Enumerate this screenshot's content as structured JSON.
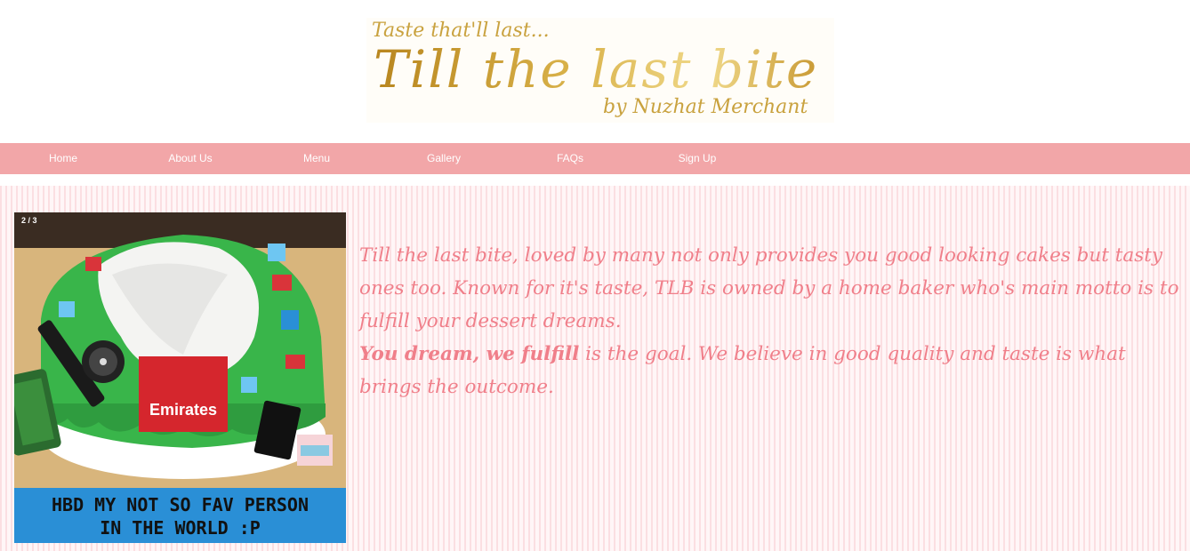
{
  "header": {
    "logo": {
      "tagline": "Taste that'll last...",
      "title": "Till the last bite",
      "byline": "by Nuzhat Merchant"
    }
  },
  "nav": {
    "items": [
      {
        "label": "Home"
      },
      {
        "label": "About Us"
      },
      {
        "label": "Menu"
      },
      {
        "label": "Gallery"
      },
      {
        "label": "FAQs"
      },
      {
        "label": "Sign Up"
      }
    ]
  },
  "slider": {
    "counter": "2 / 3",
    "image_label": "Emirates",
    "caption_line1": "HBD MY NOT SO FAV PERSON",
    "caption_line2": "IN THE WORLD :P"
  },
  "intro": {
    "paragraph1": "Till the last bite, loved by many not only provides you good looking cakes but tasty ones too. Known for it's taste, TLB is owned by a home baker who's main motto is to fulfill your dessert dreams.",
    "slogan": "You dream, we fulfill",
    "paragraph2_rest": " is the goal. We believe in good quality and taste is what brings the outcome."
  },
  "colors": {
    "nav_bg": "#f2a6a8",
    "text_pink": "#f07f8a",
    "logo_gold": "#c79b2e"
  }
}
